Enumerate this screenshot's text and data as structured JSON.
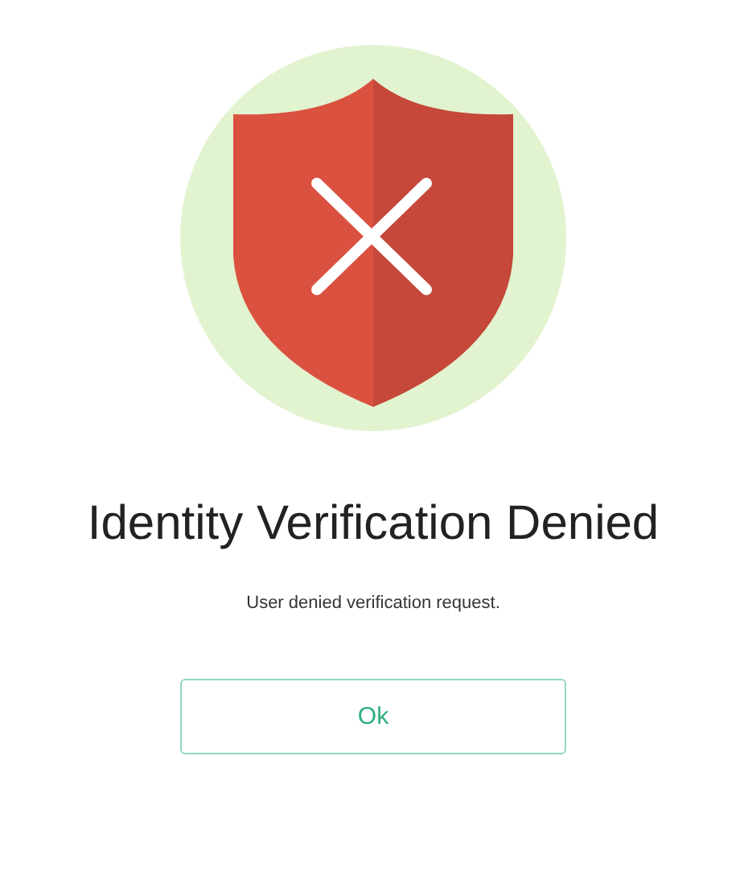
{
  "status": {
    "kind": "denied"
  },
  "title": "Identity Verification Denied",
  "message": "User denied verification request.",
  "button": {
    "label": "Ok"
  }
}
